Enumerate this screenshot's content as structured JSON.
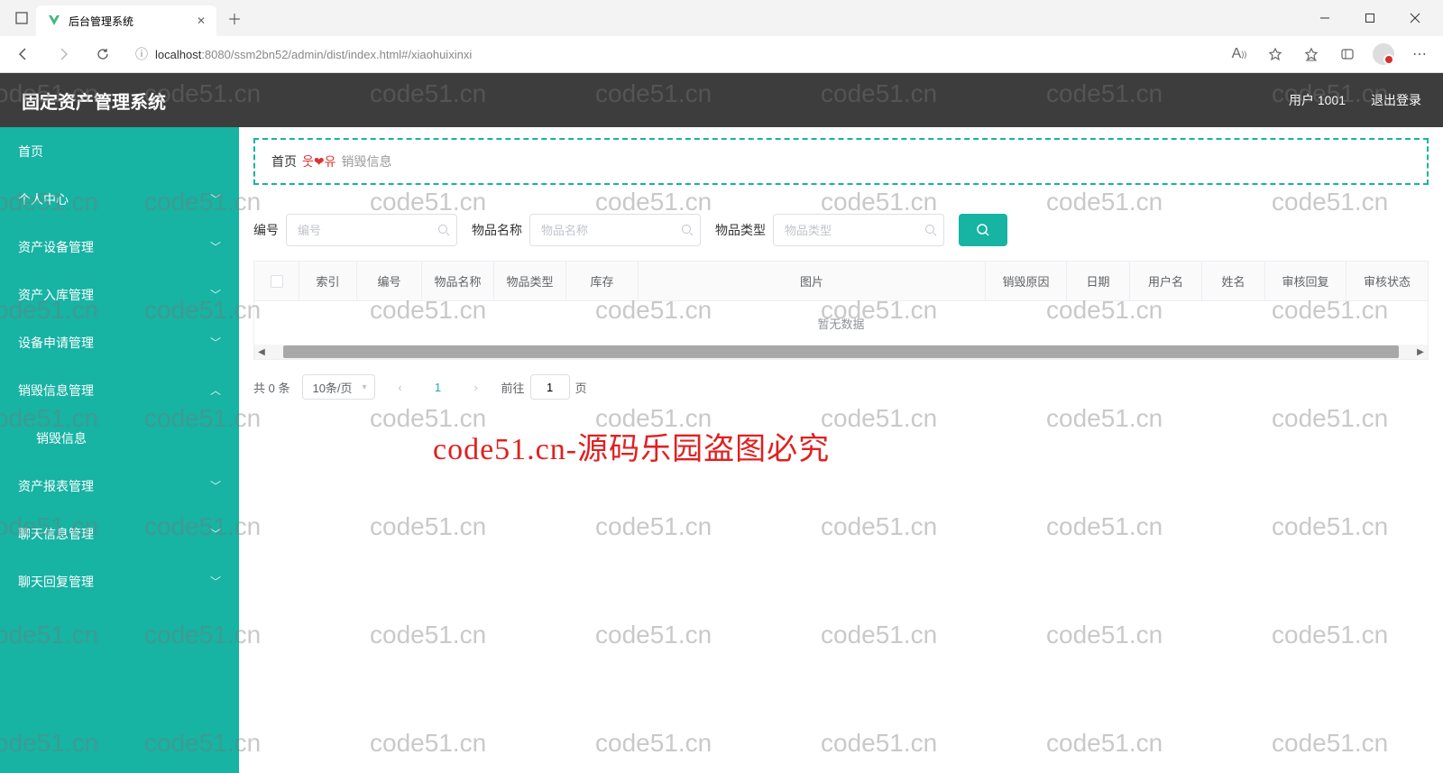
{
  "browser": {
    "tab_title": "后台管理系统",
    "url_host": "localhost",
    "url_port_path": ":8080/ssm2bn52/admin/dist/index.html#/xiaohuixinxi"
  },
  "header": {
    "app_title": "固定资产管理系统",
    "user_label": "用户 1001",
    "logout": "退出登录"
  },
  "sidebar": {
    "items": [
      {
        "label": "首页",
        "expandable": false
      },
      {
        "label": "个人中心",
        "expandable": true,
        "open": false
      },
      {
        "label": "资产设备管理",
        "expandable": true,
        "open": false
      },
      {
        "label": "资产入库管理",
        "expandable": true,
        "open": false
      },
      {
        "label": "设备申请管理",
        "expandable": true,
        "open": false
      },
      {
        "label": "销毁信息管理",
        "expandable": true,
        "open": true
      },
      {
        "label": "销毁信息",
        "expandable": false,
        "sub": true
      },
      {
        "label": "资产报表管理",
        "expandable": true,
        "open": false
      },
      {
        "label": "聊天信息管理",
        "expandable": true,
        "open": false
      },
      {
        "label": "聊天回复管理",
        "expandable": true,
        "open": false
      }
    ]
  },
  "breadcrumb": {
    "home": "首页",
    "emoji": "웃❤유",
    "current": "销毁信息"
  },
  "search": {
    "f1_label": "编号",
    "f1_placeholder": "编号",
    "f2_label": "物品名称",
    "f2_placeholder": "物品名称",
    "f3_label": "物品类型",
    "f3_placeholder": "物品类型"
  },
  "table": {
    "columns": [
      "索引",
      "编号",
      "物品名称",
      "物品类型",
      "库存",
      "图片",
      "销毁原因",
      "日期",
      "用户名",
      "姓名",
      "审核回复",
      "审核状态"
    ],
    "empty_text": "暂无数据"
  },
  "pagination": {
    "total_text": "共 0 条",
    "page_size_text": "10条/页",
    "current_page": "1",
    "jump_prefix": "前往",
    "jump_value": "1",
    "jump_suffix": "页"
  },
  "watermark": {
    "grey": "code51.cn",
    "red": "code51.cn-源码乐园盗图必究"
  }
}
